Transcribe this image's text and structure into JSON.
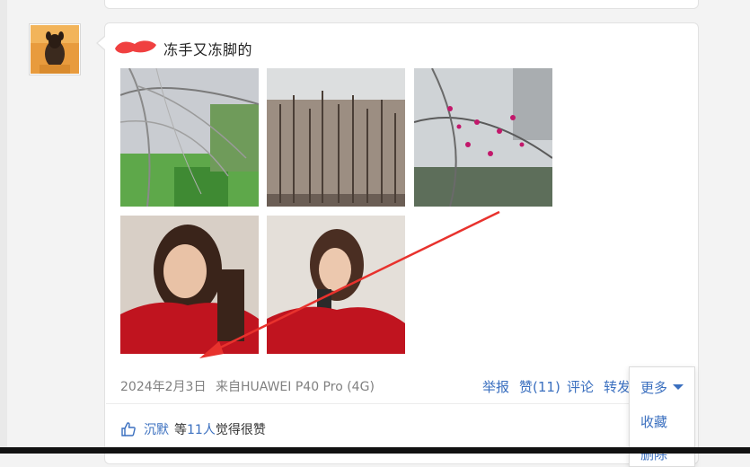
{
  "post": {
    "text": "冻手又冻脚的",
    "date": "2024年2月3日",
    "source": "来自HUAWEI P40 Pro (4G)"
  },
  "actions": {
    "report": "举报",
    "like": "赞(11)",
    "comment": "评论",
    "forward": "转发"
  },
  "more_menu": {
    "label": "更多",
    "items": [
      "收藏",
      "删除"
    ]
  },
  "likes": {
    "name": "沉默",
    "mid1": "等",
    "count": "11人",
    "suffix": "觉得很赞"
  },
  "photos": [
    {
      "subject": "icy-tree-branches"
    },
    {
      "subject": "frosted-forest"
    },
    {
      "subject": "icy-plum-blossom"
    },
    {
      "subject": "selfie-red-sweater"
    },
    {
      "subject": "mirror-selfie-red-sweater"
    }
  ],
  "colors": {
    "link": "#3a6fbf",
    "annotation_arrow": "#e8322d",
    "scribble": "#f04040"
  }
}
